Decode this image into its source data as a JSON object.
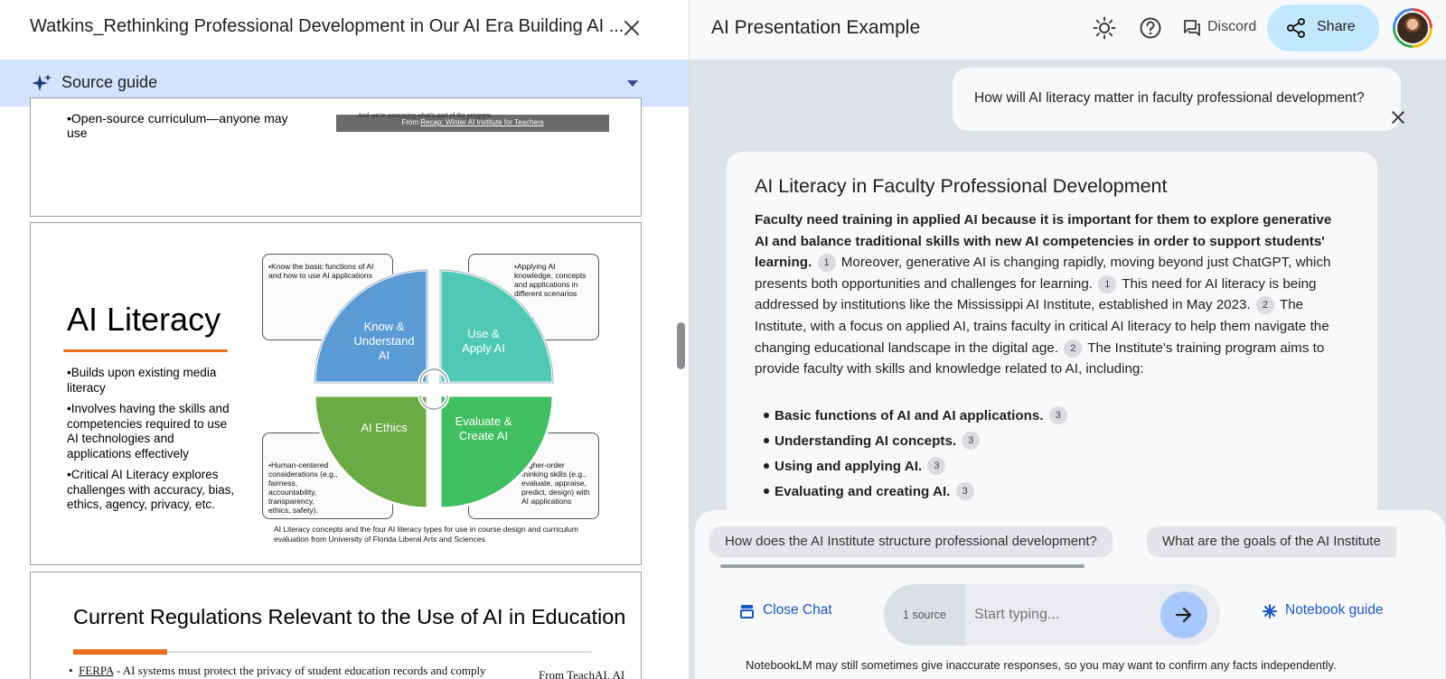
{
  "left_panel": {
    "doc_title": "Watkins_Rethinking Professional Development in Our AI Era Building AI ...",
    "source_guide_label": "Source guide",
    "slide1": {
      "bullet": "•Open-source curriculum—anyone may use",
      "image_top_text": "And we're assessing what's part of the program.",
      "caption_prefix": "From ",
      "caption_link": "Recap: Winter AI Institute for Teachers"
    },
    "slide2": {
      "title": "AI Literacy",
      "bullets": [
        "•Builds upon existing media literacy",
        "•Involves having the skills and competencies required to use AI technologies and applications effectively",
        "•Critical AI Literacy explores challenges with accuracy, bias, ethics, agency, privacy, etc."
      ],
      "diagram": {
        "quadrants": [
          {
            "label_lines": [
              "Know &",
              "Understand",
              "AI"
            ],
            "color": "#5b9bd5"
          },
          {
            "label_lines": [
              "Use &",
              "Apply AI"
            ],
            "color": "#4fc9b4"
          },
          {
            "label_lines": [
              "AI Ethics"
            ],
            "color": "#6aab46"
          },
          {
            "label_lines": [
              "Evaluate &",
              "Create AI"
            ],
            "color": "#3fbf5f"
          }
        ],
        "callouts": [
          "•Know the basic functions of AI and how to use AI applications",
          "•Applying AI knowledge, concepts and applications in different scenarios",
          "•Human-centered considerations (e.g., fairness, accountability, transparency, ethics, safety).",
          "Higher-order thinking skills (e.g., evaluate, appraise, predict, design) with AI applications"
        ],
        "caption": "AI Literacy concepts and the four AI literacy types for use in course design and curriculum evaluation from University of Florida Liberal Arts and Sciences"
      }
    },
    "slide3": {
      "title": "Current Regulations Relevant to the Use of AI in Education",
      "bullet_marker": "•",
      "bullet_link": "FERPA",
      "bullet_text": " - AI systems must protect the privacy of student education records and comply",
      "from_text": "From TeachAI. AI"
    }
  },
  "header": {
    "notebook_title": "AI Presentation Example",
    "discord_label": "Discord",
    "share_label": "Share"
  },
  "chat": {
    "question": "How will AI literacy matter in faculty professional development?",
    "answer": {
      "title": "AI Literacy in Faculty Professional Development",
      "bold_intro": "Faculty need training in applied AI because it is important for them to explore generative AI and balance traditional skills with new AI competencies in order to support students' learning.",
      "cite1": "1",
      "sentence2": " Moreover, generative AI is changing rapidly, moving beyond just ChatGPT, which presents both opportunities and challenges for learning.",
      "cite2": "1",
      "sentence3": " This need for AI literacy is being addressed by institutions like the Mississippi AI Institute, established in May 2023.",
      "cite3": "2",
      "sentence4": " The Institute, with a focus on applied AI, trains faculty in critical AI literacy to help them navigate the changing educational landscape in the digital age.",
      "cite4": "2",
      "sentence5": " The Institute's training program aims to provide faculty with skills and knowledge related to AI, including:",
      "list": [
        {
          "text": "Basic functions of AI and AI applications.",
          "cite": "3"
        },
        {
          "text": "Understanding AI concepts.",
          "cite": "3"
        },
        {
          "text": "Using and applying AI.",
          "cite": "3"
        },
        {
          "text": "Evaluating and creating AI.",
          "cite": "3"
        }
      ]
    },
    "suggestions": [
      "How does the AI Institute structure professional development?",
      "What are the goals of the AI Institute"
    ],
    "close_chat_label": "Close Chat",
    "source_count": "1 source",
    "input_placeholder": "Start typing...",
    "notebook_guide_label": "Notebook guide",
    "disclaimer": "NotebookLM may still sometimes give inaccurate responses, so you may want to confirm any facts independently."
  },
  "colors": {
    "source_guide_bg": "#d3e3fd",
    "share_bg": "#c2e7ff",
    "send_bg": "#a8c7fa",
    "link_blue": "#1a56c9",
    "accent_orange": "#e8701a"
  },
  "icons": [
    "close-icon",
    "sparkle-icon",
    "caret-down-icon",
    "theme-toggle-icon",
    "help-icon",
    "discord-icon",
    "share-icon",
    "chat-icon",
    "send-arrow-icon",
    "asterisk-icon"
  ]
}
